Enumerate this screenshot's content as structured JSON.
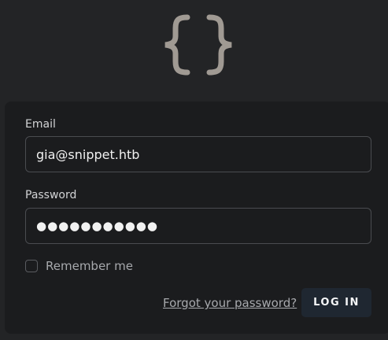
{
  "logo": {
    "icon": "curly-braces-icon",
    "color": "#a09a93"
  },
  "form": {
    "email_label": "Email",
    "email_value": "gia@snippet.htb",
    "password_label": "Password",
    "password_value": "●●●●●●●●●●●",
    "remember_label": "Remember me",
    "remember_checked": false,
    "forgot_link": "Forgot your password?",
    "login_button": "LOG IN"
  }
}
